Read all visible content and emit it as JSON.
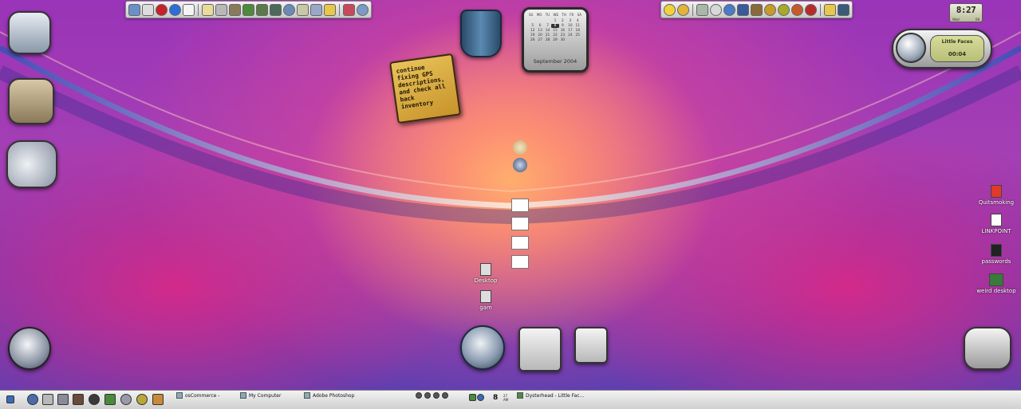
{
  "note": {
    "lines": [
      "continue",
      "fixing GPS",
      "descriptions,",
      "and check all",
      "back",
      "inventory"
    ]
  },
  "calendar": {
    "day_headers": [
      "SU",
      "MO",
      "TU",
      "WE",
      "TH",
      "FR",
      "SA"
    ],
    "dates": [
      "",
      "",
      "",
      "1",
      "2",
      "3",
      "4",
      "5",
      "6",
      "7",
      "8",
      "9",
      "10",
      "11",
      "12",
      "13",
      "14",
      "15",
      "16",
      "17",
      "18",
      "19",
      "20",
      "21",
      "22",
      "23",
      "24",
      "25",
      "26",
      "27",
      "28",
      "29",
      "30",
      "",
      ""
    ],
    "today": "8",
    "month_label": "September 2004"
  },
  "player": {
    "track_title": "Little Faces",
    "elapsed": "00:04"
  },
  "clock": {
    "time": "8:27",
    "day": "Wed",
    "date": "08"
  },
  "desktop_icons": {
    "center": [
      {
        "label": "Desktop"
      },
      {
        "label": "gam"
      }
    ],
    "right": [
      {
        "label": "Quitsmoking",
        "color": "#e03a2a"
      },
      {
        "label": "LINKPOINT",
        "color": "#ffffff"
      },
      {
        "label": "passwords",
        "color": "#222222"
      },
      {
        "label": "weird desktop",
        "color": "#3a7a3a"
      }
    ]
  },
  "taskbar": {
    "tasks": [
      {
        "label": "osCommerce -"
      },
      {
        "label": "My Computer"
      },
      {
        "label": "Adobe Photoshop"
      }
    ],
    "clock": "8",
    "clock_minutes": "27",
    "clock_ampm": "AM",
    "media_task": "Dysterhead - Little Fac..."
  },
  "icons": {
    "top_left_toolbar": [
      "finder-icon",
      "mail-icon",
      "stop-icon",
      "info-icon",
      "window-icon",
      "drive-icon",
      "disk-icon",
      "folder-icon",
      "download-icon",
      "share-icon",
      "network-icon",
      "browser-icon",
      "calculator-icon",
      "battery-icon",
      "clock-icon",
      "user-icon"
    ],
    "top_right_toolbar": [
      "smiley-icon",
      "smiley-icon",
      "tag-icon",
      "magnifier-icon",
      "globe-icon",
      "bluetooth-icon",
      "tool-icon",
      "coin-icon",
      "coin-icon",
      "record-icon",
      "power-icon",
      "battery-icon",
      "trash-icon"
    ],
    "dock_left": [
      "finder-icon",
      "documents-icon",
      "drive-icon"
    ],
    "colors": {
      "accent": "#a43fb4",
      "note": "#d7a941",
      "panel": "#e6e6e6"
    }
  }
}
